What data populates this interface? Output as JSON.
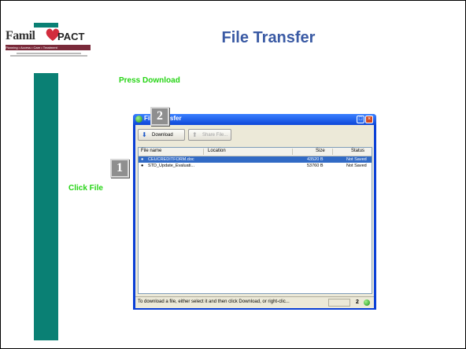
{
  "logo": {
    "family_text": "Famil",
    "pact_text": "PACT",
    "strip_text": "Planning • Access • Care • Treatment"
  },
  "slide": {
    "title": "File Transfer",
    "callout_press": "Press Download",
    "callout_click": "Click File",
    "step1": "1",
    "step2": "2"
  },
  "window": {
    "title": "File Transfer",
    "toolbar": {
      "download_label": "Download",
      "share_label": "Share File..."
    },
    "columns": [
      "File name",
      "Location",
      "Size",
      "Status"
    ],
    "rows": [
      {
        "name": "CEUCREDITFORM.doc",
        "size": "43520 B",
        "status": "Not Saved",
        "selected": true
      },
      {
        "name": "STD_Update_Evaluati...",
        "size": "53760 B",
        "status": "Not Saved",
        "selected": false
      }
    ],
    "status_message": "To download a file, either select it and then click Download, or right-clic...",
    "status_count": "2"
  },
  "colors": {
    "accent_bar": "#0a8074",
    "title": "#3a5aa4",
    "callout": "#25d414",
    "selection": "#316ac5"
  }
}
